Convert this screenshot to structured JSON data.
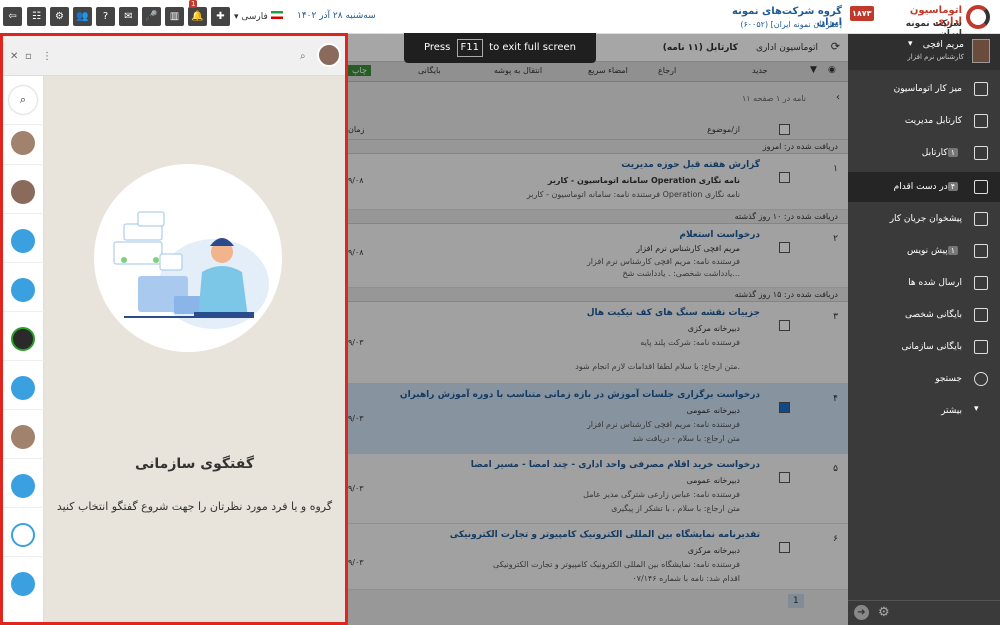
{
  "topbar": {
    "org_title": "گروه شرکت‌های نمونه ایران",
    "org_subtitle": "[سازمان نمونه ایران] (۶۰۰۵۲)",
    "brand_line1": "اتوماسیون اداری",
    "brand_line2": "شرکت نمونه ایران",
    "brand_badge": "۱۸۷۳",
    "date_text": "سه‌شنبه ۲۸ آذر ۱۴۰۲",
    "language": "فارسی",
    "notification_count": "1"
  },
  "fullscreen_toast": {
    "prefix": "Press",
    "key": "F11",
    "suffix": "to exit full screen"
  },
  "user": {
    "name": "مریم افچی",
    "role": "کارشناس نرم افزار"
  },
  "breadcrumb": {
    "root": "اتوماسیون اداری",
    "current": "کارتابل (۱۱ نامه)"
  },
  "toolbar": {
    "new_label": "جدید",
    "reply_label": "ارجاع",
    "quick_sign_label": "امضاء سریع",
    "move_label": "انتقال به پوشه",
    "archive_label": "بایگانی",
    "print_label": "چاپ"
  },
  "pagination": {
    "text": "۱۱ نامه در ۱ صفحه",
    "current_page": "1"
  },
  "table_header": {
    "subject": "از/موضوع",
    "date": "زمان"
  },
  "sections": [
    {
      "label": "دریافت شده در: امروز"
    },
    {
      "label": "دریافت شده در: ۱۰ روز گذشته"
    },
    {
      "label": "دریافت شده در: ۱۵ روز گذشته"
    }
  ],
  "letters": [
    {
      "num": "۱",
      "date": "۹/۰۸",
      "subject": "گزارش هفته قبل حوزه مدیریت",
      "line1": "سامانه اتوماسیون - کاربر Operation نامه نگاری",
      "line2": "فرستنده نامه: سامانه اتوماسیون - کاربر Operation نامه نگاری",
      "line3": ""
    },
    {
      "num": "۲",
      "date": "۹/۰۸",
      "subject": "درخواست استعلام",
      "line1": "مریم افچی کارشناس نرم افزار",
      "line2": "فرستنده نامه: مریم افچی کارشناس نرم افزار",
      "line3": "یادداشت شخصی: . یادداشت شخ..."
    },
    {
      "num": "۳",
      "date": "۹/۰۳",
      "subject": "جزییات نقشه سنگ های کف نیکیت هال",
      "line1": "دبیرخانه مرکزی",
      "line2": "فرستنده نامه: شرکت پلند پایه",
      "line3": "متن ارجاع: با سلام لطفا اقدامات لازم انجام شود."
    },
    {
      "num": "۴",
      "date": "۹/۰۳",
      "subject": "درخواست برگزاری جلسات آموزش در بازه زمانی متناسب با دوره آموزش راهبران",
      "line1": "دبیرخانه عمومی",
      "line2": "فرستنده نامه: مریم افچی کارشناس نرم افزار",
      "line3": "متن ارجاع: با سلام - دریافت شد"
    },
    {
      "num": "۵",
      "date": "۹/۰۳",
      "subject": "درخواست خرید اقلام مصرفی واحد اداری - چند امضا - مسیر امضا",
      "line1": "دبیرخانه عمومی",
      "line2": "فرستنده نامه: عباس زارعی شترگی مدیر عامل",
      "line3": "متن ارجاع: با سلام ، با تشکر از پیگیری"
    },
    {
      "num": "۶",
      "date": "۹/۰۳",
      "subject": "تقدیرنامه نمایشگاه بین المللی الکترونیک کامپیوتر و تجارت الکترونیکی",
      "line1": "دبیرخانه مرکزی",
      "line2": "فرستنده نامه: نمایشگاه بین المللی الکترونیک کامپیوتر و تجارت الکترونیکی",
      "line3": "اقدام شد: نامه با شماره ۰۷/۱۴۶"
    }
  ],
  "sidebar": {
    "items": [
      {
        "label": "میز کار اتوماسیون",
        "badge": ""
      },
      {
        "label": "کارتابل مدیریت",
        "badge": ""
      },
      {
        "label": "کارتابل",
        "badge": "۱"
      },
      {
        "label": "در دست اقدام",
        "badge": "۴"
      },
      {
        "label": "پیشخوان جریان کار",
        "badge": ""
      },
      {
        "label": "پیش نویس",
        "badge": "۱"
      },
      {
        "label": "ارسال شده ها",
        "badge": ""
      },
      {
        "label": "بایگانی شخصی",
        "badge": ""
      },
      {
        "label": "بایگانی سازمانی",
        "badge": ""
      },
      {
        "label": "جستجو",
        "badge": ""
      },
      {
        "label": "بیشتر",
        "badge": ""
      }
    ]
  },
  "chat": {
    "empty_title": "گفتگوی سازمانی",
    "empty_subtitle": "گروه و یا فرد مورد نظرتان را جهت شروع گفتگو انتخاب کنید",
    "contacts": [
      "avatar-man",
      "avatar-man",
      "group-icon",
      "group-icon",
      "avatar-woman",
      "group-icon",
      "avatar-man",
      "group-icon",
      "bot-icon",
      "group-icon"
    ]
  },
  "colors": {
    "accent_red": "#e0251f",
    "sidebar_bg": "#3a3a3a",
    "link_blue": "#1e5a96",
    "selected_row": "#cfe3f5",
    "badge_red": "#c0392b"
  }
}
